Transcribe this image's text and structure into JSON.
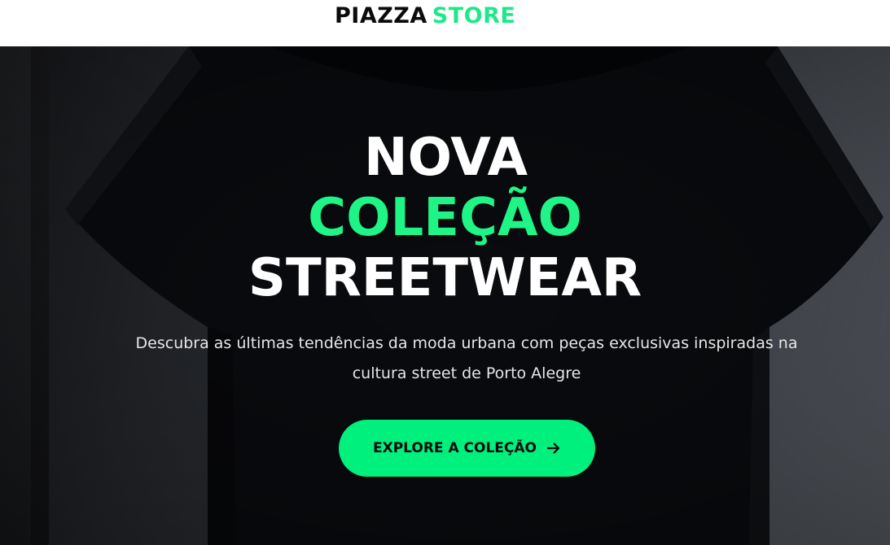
{
  "header": {
    "logo_part1": "PIAZZA",
    "logo_part2": "STORE"
  },
  "hero": {
    "title_line1": "NOVA",
    "title_line2": "COLEÇÃO",
    "title_line3": "STREETWEAR",
    "subtitle": "Descubra as últimas tendências da moda urbana com peças exclusivas inspiradas na cultura street de Porto Alegre",
    "cta_label": "EXPLORE A COLEÇÃO",
    "cta_icon": "arrow-right-icon",
    "background_image": "black-tshirt-photo"
  },
  "colors": {
    "accent": "#00f07e",
    "text_dark": "#0b0b0b",
    "text_light": "#ffffff"
  }
}
